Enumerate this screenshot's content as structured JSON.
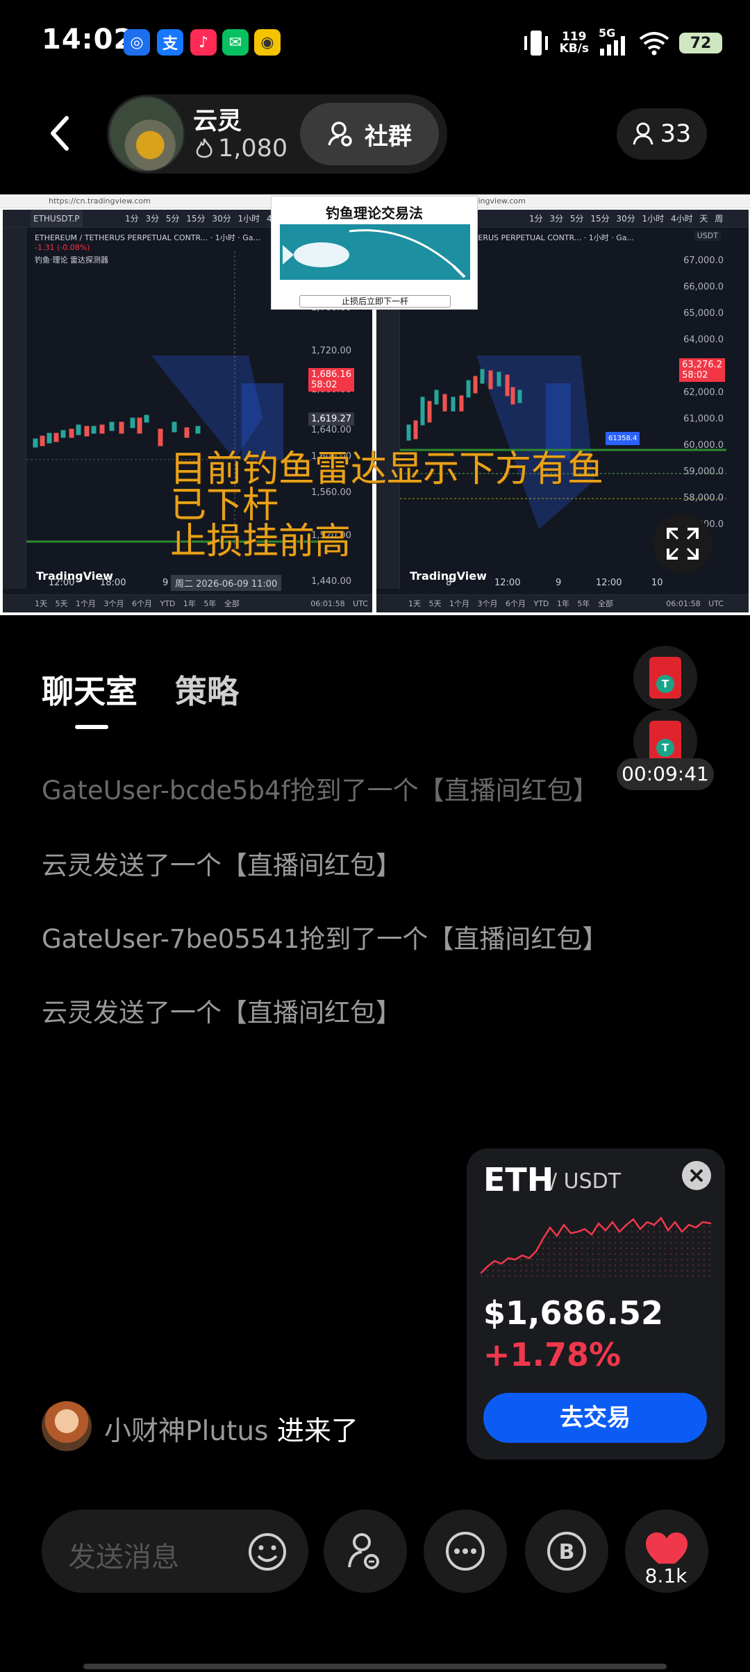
{
  "status_bar": {
    "time": "14:02",
    "net_speed_value": "119",
    "net_speed_unit": "KB/s",
    "network": "5G",
    "battery": "72",
    "app_icons": [
      "maps-icon",
      "alipay-icon",
      "douyin-icon",
      "wechat-icon",
      "app-icon"
    ],
    "alipay_glyph": "支"
  },
  "header": {
    "host_name": "云灵",
    "host_likes": "1,080",
    "group_button": "社群",
    "viewer_count": "33"
  },
  "video": {
    "left_panel": {
      "url": "https://cn.tradingview.com",
      "symbol": "ETHUSDT.P",
      "title": "ETHEREUM / TETHERUS PERPETUAL CONTR... · 1小时 · Ga...",
      "change": "-1.31 (-0.08%)",
      "indicator": "钓鱼·理论 雷达探测器",
      "timeframes": "1分 3分 5分 15分 30分 1小时 4小时",
      "prices": [
        "1,700.00",
        "1,720.00",
        "1,660.00",
        "1,640.00",
        "1,600.00",
        "1,560.00",
        "1,520.00",
        "1,440.00"
      ],
      "price_tag": "1,686.16",
      "price_tag_time": "58:02",
      "cross_price": "1,619.27",
      "x_ticks": [
        "12:00",
        "18:00",
        "9"
      ],
      "cursor_date": "周二 2026-06-09   11:00",
      "ranges": "1天 5天 1个月 3个月 6个月 YTD 1年 5年 全部",
      "clock": "06:01:58 UTC",
      "logo": "TradingView"
    },
    "right_panel": {
      "url": "https://cn.tradingview.com",
      "title": "ETHEREUM / TETHERUS PERPETUAL CONTR... · 1小时 · Ga...",
      "timeframes": "1分 3分 5分 15分 30分 1小时 4小时 天 周",
      "currency": "USDT",
      "prices": [
        "67,000.0",
        "66,000.0",
        "65,000.0",
        "64,000.0",
        "62,000.0",
        "61,000.0",
        "60,000.0",
        "59,000.0",
        "58,000.0",
        "57,000.0"
      ],
      "price_tag": "63,276.2",
      "price_tag_time": "58:02",
      "marker": "61358.4",
      "x_ticks": [
        "8",
        "12:00",
        "9",
        "12:00",
        "10"
      ],
      "ranges": "1天 5天 1个月 3个月 6个月 YTD 1年 5年 全部",
      "clock": "06:01:58 UTC",
      "logo": "TradingView"
    },
    "fish_card": {
      "title": "钓鱼理论交易法",
      "caption": "止损后立即下一杆"
    },
    "overlay_lines": [
      "目前钓鱼雷达显示下方有鱼",
      "已下杆",
      "止损挂前高"
    ]
  },
  "tabs": {
    "chat": "聊天室",
    "strategy": "策略"
  },
  "timer": "00:09:41",
  "chat_messages": [
    "GateUser-bcde5b4f抢到了一个【直播间红包】",
    "云灵发送了一个【直播间红包】",
    "GateUser-7be05541抢到了一个【直播间红包】",
    "云灵发送了一个【直播间红包】"
  ],
  "market_card": {
    "symbol": "ETH",
    "quote": "/ USDT",
    "price": "$1,686.52",
    "change": "+1.78%",
    "trade_button": "去交易",
    "accent": "#f0384c",
    "button_color": "#0b5cf5"
  },
  "entry": {
    "user": "小财神Plutus",
    "action": "进来了"
  },
  "input": {
    "placeholder": "发送消息"
  },
  "likes": "8.1k"
}
